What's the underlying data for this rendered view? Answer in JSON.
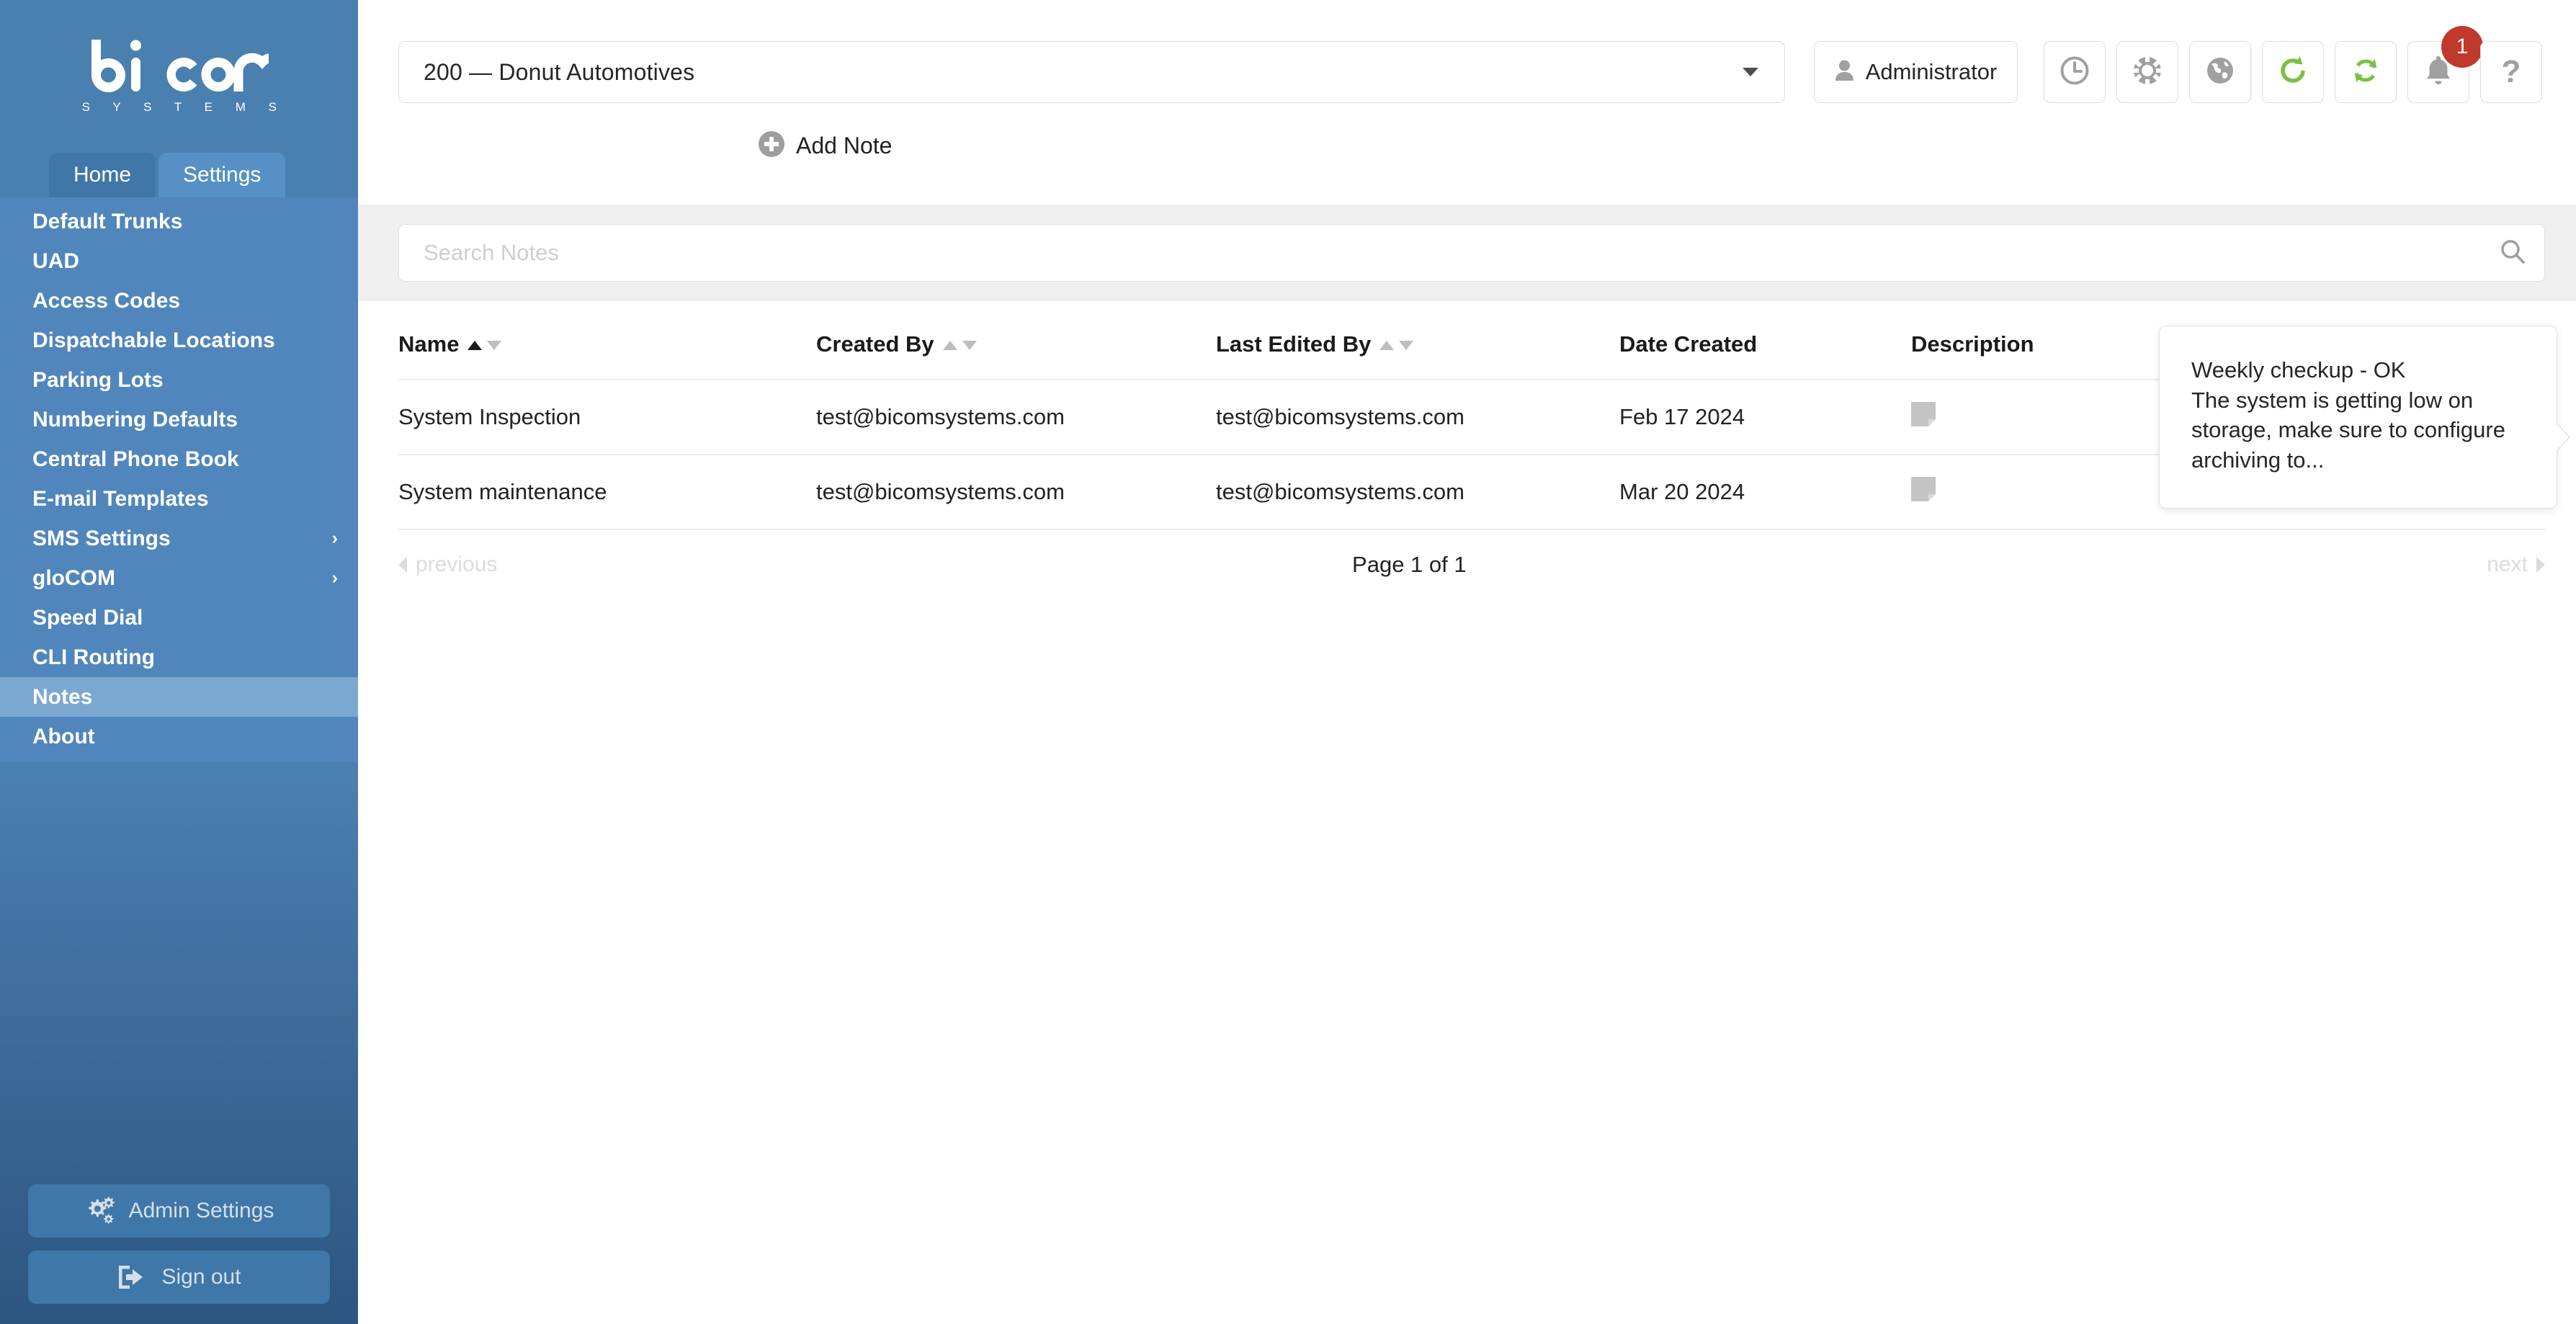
{
  "brand": {
    "name": "bicom",
    "subtitle": "S Y S T E M S"
  },
  "sidebar": {
    "tabs": [
      {
        "label": "Home",
        "active": false
      },
      {
        "label": "Settings",
        "active": true
      }
    ],
    "items": [
      {
        "label": "Default Trunks",
        "submenu": false,
        "selected": false
      },
      {
        "label": "UAD",
        "submenu": false,
        "selected": false
      },
      {
        "label": "Access Codes",
        "submenu": false,
        "selected": false
      },
      {
        "label": "Dispatchable Locations",
        "submenu": false,
        "selected": false
      },
      {
        "label": "Parking Lots",
        "submenu": false,
        "selected": false
      },
      {
        "label": "Numbering Defaults",
        "submenu": false,
        "selected": false
      },
      {
        "label": "Central Phone Book",
        "submenu": false,
        "selected": false
      },
      {
        "label": "E-mail Templates",
        "submenu": false,
        "selected": false
      },
      {
        "label": "SMS Settings",
        "submenu": true,
        "selected": false
      },
      {
        "label": "gloCOM",
        "submenu": true,
        "selected": false
      },
      {
        "label": "Speed Dial",
        "submenu": false,
        "selected": false
      },
      {
        "label": "CLI Routing",
        "submenu": false,
        "selected": false
      },
      {
        "label": "Notes",
        "submenu": false,
        "selected": true
      },
      {
        "label": "About",
        "submenu": false,
        "selected": false
      }
    ],
    "chevron": "›",
    "admin_settings_label": "Admin Settings",
    "sign_out_label": "Sign out"
  },
  "topbar": {
    "company": "200  —  Donut Automotives",
    "user": "Administrator",
    "icons": [
      {
        "name": "clock-icon"
      },
      {
        "name": "lifebuoy-icon"
      },
      {
        "name": "globe-icon"
      },
      {
        "name": "reload-icon"
      },
      {
        "name": "sync-icon"
      },
      {
        "name": "bell-icon"
      },
      {
        "name": "help-icon"
      }
    ],
    "help_glyph": "?",
    "notification_count": "1"
  },
  "actions": {
    "add_note_label": "Add Note"
  },
  "search": {
    "placeholder": "Search Notes",
    "value": ""
  },
  "table": {
    "columns": [
      {
        "label": "Name",
        "sortable": true,
        "sorted": "asc"
      },
      {
        "label": "Created By",
        "sortable": true,
        "sorted": "none"
      },
      {
        "label": "Last Edited By",
        "sortable": true,
        "sorted": "none"
      },
      {
        "label": "Date Created",
        "sortable": false,
        "sorted": "none"
      },
      {
        "label": "Description",
        "sortable": false,
        "sorted": "none"
      }
    ],
    "rows": [
      {
        "name": "System Inspection",
        "created_by": "test@bicomsystems.com",
        "last_edited_by": "test@bicomsystems.com",
        "date_created": "Feb 17 2024",
        "description": ""
      },
      {
        "name": "System maintenance",
        "created_by": "test@bicomsystems.com",
        "last_edited_by": "test@bicomsystems.com",
        "date_created": "Mar 20 2024",
        "description": ""
      }
    ]
  },
  "pagination": {
    "previous_label": "previous",
    "page_label": "Page 1 of 1",
    "next_label": "next"
  },
  "tooltip": {
    "line1": "Weekly checkup - OK",
    "line2": "The system is getting low on storage, make sure to configure archiving to..."
  },
  "colors": {
    "sidebar_top": "#4a80b0",
    "sidebar_bottom": "#2d5581",
    "menu_bg": "#5086bb",
    "menu_selected": "#7ba8d0",
    "tab_active": "#5690c4",
    "accent_green": "#7ac043",
    "badge_red": "#c0392b",
    "band_gray": "#efefef"
  }
}
